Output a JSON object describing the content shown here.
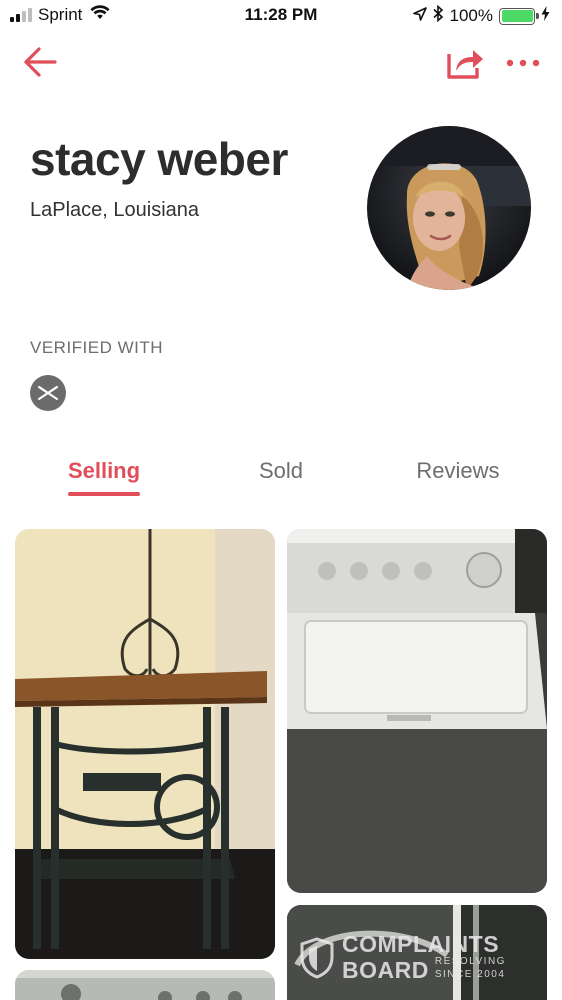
{
  "status_bar": {
    "carrier": "Sprint",
    "time": "11:28 PM",
    "battery": "100%"
  },
  "nav": {
    "back_icon": "back-arrow-icon",
    "share_icon": "share-icon",
    "more_icon": "more-dots-icon",
    "accent_color": "#e04e5a"
  },
  "profile": {
    "name": "stacy weber",
    "location": "LaPlace, Louisiana"
  },
  "verification": {
    "label": "VERIFIED WITH",
    "icon": "email-verified-icon"
  },
  "tabs": [
    {
      "label": "Selling",
      "active": true
    },
    {
      "label": "Sold",
      "active": false
    },
    {
      "label": "Reviews",
      "active": false
    }
  ],
  "listings": [
    {
      "subject": "singer sewing machine table with lamp"
    },
    {
      "subject": "white top-load washing machine"
    },
    {
      "subject": "appliance control panel"
    },
    {
      "subject": "appliance"
    }
  ],
  "watermark": {
    "line1": "COMPLAINTS",
    "line2": "BOARD",
    "tagline1": "RESOLVING",
    "tagline2": "SINCE 2004"
  }
}
